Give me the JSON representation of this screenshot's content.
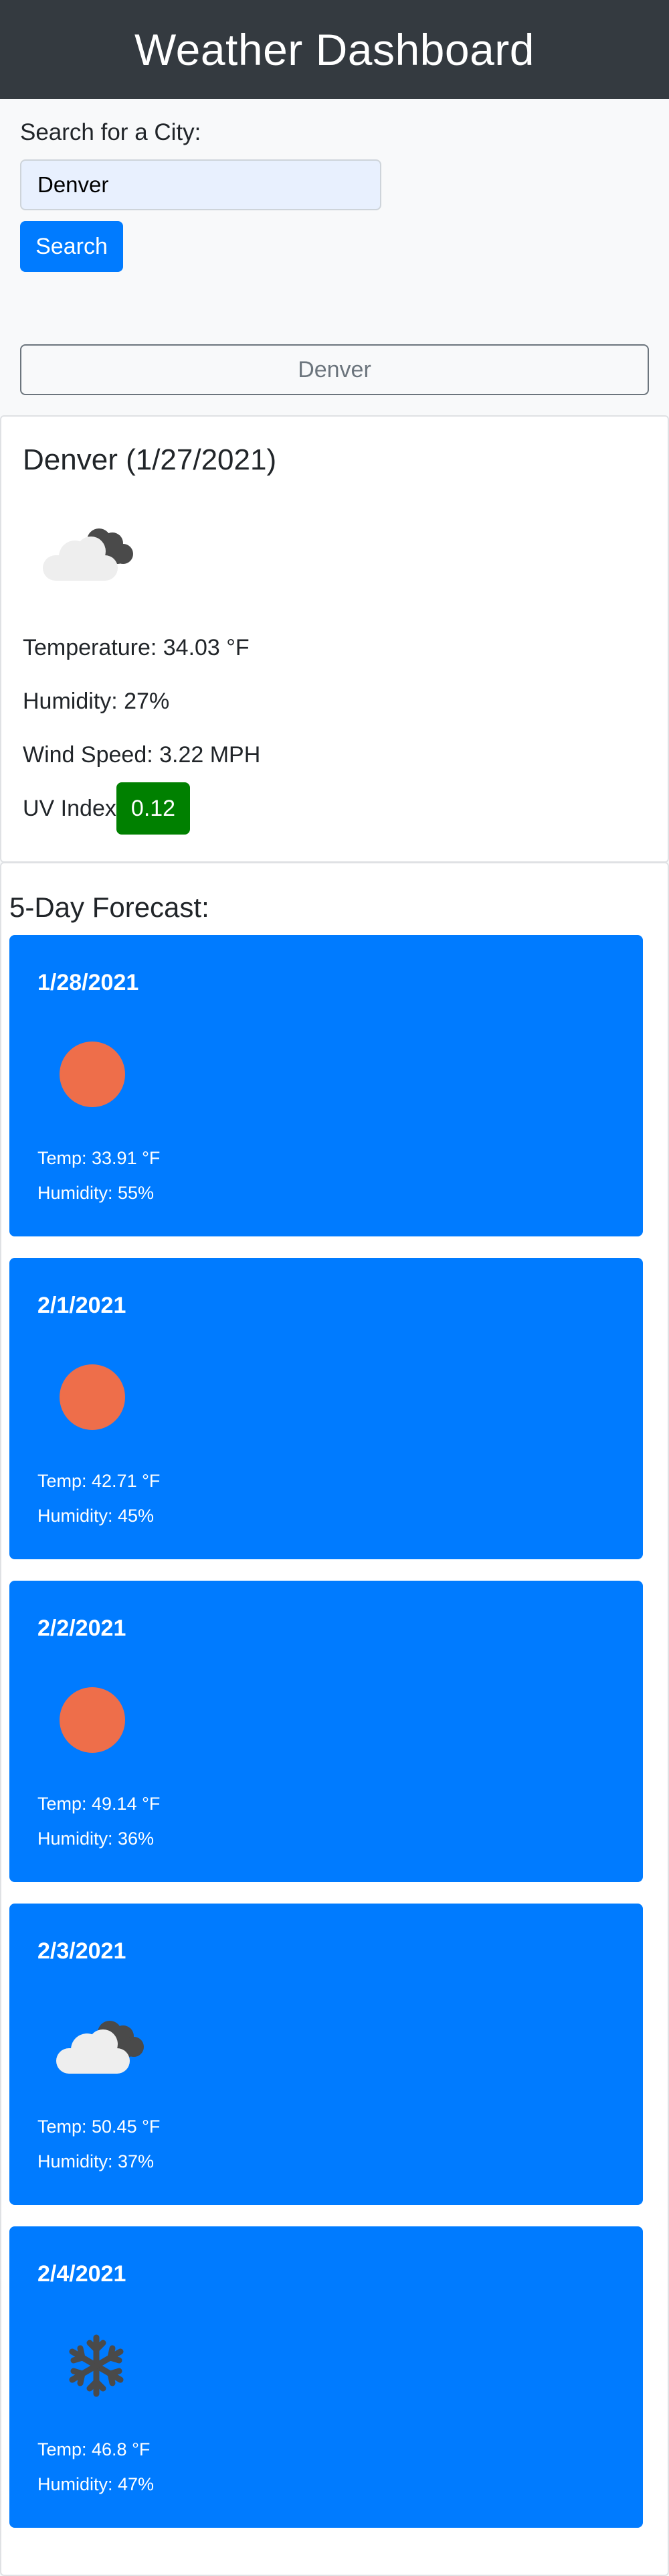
{
  "header": {
    "title": "Weather Dashboard"
  },
  "search": {
    "label": "Search for a City:",
    "value": "Denver",
    "button_label": "Search"
  },
  "history": [
    "Denver"
  ],
  "current": {
    "title": "Denver (1/27/2021)",
    "icon": "cloudy-icon",
    "temperature": "Temperature: 34.03 °F",
    "humidity": "Humidity: 27%",
    "wind": "Wind Speed: 3.22 MPH",
    "uv_label": "UV Index:",
    "uv_value": "0.12",
    "uv_color": "#008000"
  },
  "forecast": {
    "title": "5-Day Forecast:",
    "days": [
      {
        "date": "1/28/2021",
        "icon": "sun-icon",
        "temp": "Temp: 33.91 °F",
        "humidity": "Humidity: 55%"
      },
      {
        "date": "2/1/2021",
        "icon": "sun-icon",
        "temp": "Temp: 42.71 °F",
        "humidity": "Humidity: 45%"
      },
      {
        "date": "2/2/2021",
        "icon": "sun-icon",
        "temp": "Temp: 49.14 °F",
        "humidity": "Humidity: 36%"
      },
      {
        "date": "2/3/2021",
        "icon": "cloudy-icon",
        "temp": "Temp: 50.45 °F",
        "humidity": "Humidity: 37%"
      },
      {
        "date": "2/4/2021",
        "icon": "snow-icon",
        "temp": "Temp: 46.8 °F",
        "humidity": "Humidity: 47%"
      }
    ]
  },
  "colors": {
    "accent": "#007bff",
    "header_bg": "#343a40",
    "sun": "#ee6e4a"
  }
}
